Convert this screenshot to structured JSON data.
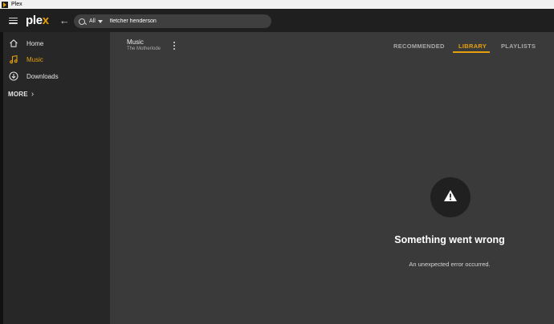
{
  "window": {
    "title": "Plex"
  },
  "header": {
    "logo_text": "ple",
    "logo_accent": "x",
    "back_glyph": "←"
  },
  "search": {
    "scope": "All",
    "query": "fletcher henderson"
  },
  "nav": {
    "items": [
      {
        "label": "Home",
        "icon": "home-icon"
      },
      {
        "label": "Music",
        "icon": "music-note-icon",
        "active": true
      },
      {
        "label": "Downloads",
        "icon": "download-icon"
      }
    ],
    "more_label": "MORE",
    "more_chevron": "›"
  },
  "library": {
    "title": "Music",
    "subtitle": "The Motherlode"
  },
  "tabs": [
    {
      "label": "RECOMMENDED"
    },
    {
      "label": "LIBRARY",
      "active": true
    },
    {
      "label": "PLAYLISTS"
    }
  ],
  "error": {
    "icon": "warning-icon",
    "title": "Something went wrong",
    "message": "An unexpected error occurred."
  },
  "colors": {
    "accent": "#e5a00d",
    "topbar": "#1f1f1f",
    "sidebar": "#272727",
    "content": "#3a3a3a"
  }
}
